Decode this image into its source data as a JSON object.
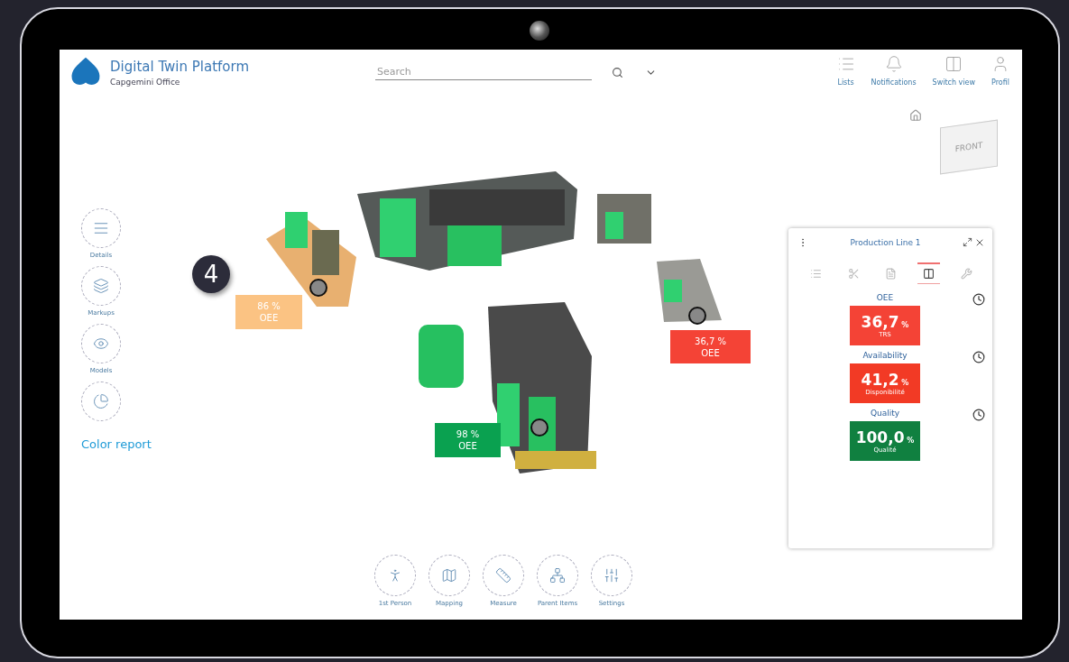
{
  "app": {
    "title": "Digital Twin Platform",
    "subtitle": "Capgemini Office"
  },
  "search": {
    "placeholder": "Search"
  },
  "header_actions": [
    {
      "label": "Lists"
    },
    {
      "label": "Notifications"
    },
    {
      "label": "Switch view"
    },
    {
      "label": "Profil"
    }
  ],
  "view_cube": {
    "face": "FRONT"
  },
  "sidebar": {
    "items": [
      {
        "kind": "labeled",
        "label": "Details"
      },
      {
        "kind": "labeled",
        "label": "Markups"
      },
      {
        "kind": "labeled",
        "label": "Models"
      },
      {
        "kind": "icon"
      }
    ],
    "link": "Color report"
  },
  "scene": {
    "badge": "4",
    "markers": [
      {
        "value": "86 %",
        "label": "OEE",
        "color": "#fbc383"
      },
      {
        "value": "36,7 %",
        "label": "OEE",
        "color": "#f44336"
      },
      {
        "value": "98 %",
        "label": "OEE",
        "color": "#0aa150"
      }
    ]
  },
  "toolbar": [
    {
      "label": "1st Person"
    },
    {
      "label": "Mapping"
    },
    {
      "label": "Measure"
    },
    {
      "label": "Parent Items"
    },
    {
      "label": "Settings"
    }
  ],
  "panel": {
    "title": "Production Line 1",
    "tabs": [
      {
        "selected": false
      },
      {
        "selected": false
      },
      {
        "selected": false
      },
      {
        "selected": true
      },
      {
        "selected": false
      }
    ],
    "metrics": [
      {
        "title": "OEE",
        "value": "36,7",
        "unit": "%",
        "label": "TRS",
        "color": "#f44336"
      },
      {
        "title": "Availability",
        "value": "41,2",
        "unit": "%",
        "label": "Disponibilité",
        "color": "#f23a25"
      },
      {
        "title": "Quality",
        "value": "100,0",
        "unit": "%",
        "label": "Qualité",
        "color": "#108040"
      }
    ]
  }
}
